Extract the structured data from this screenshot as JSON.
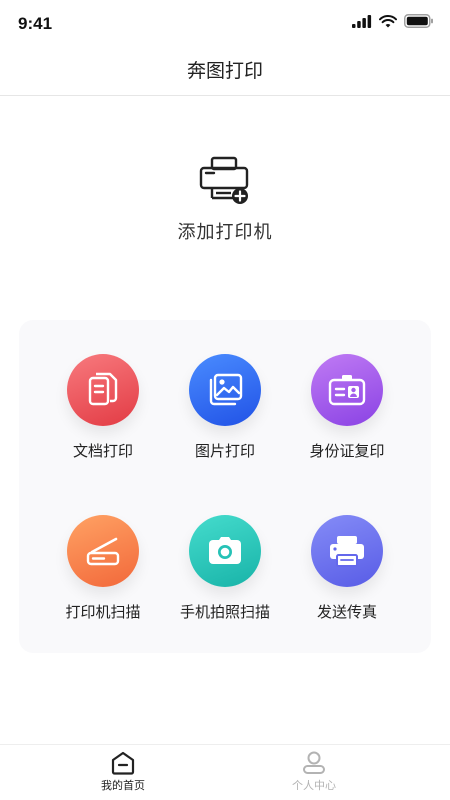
{
  "status_bar": {
    "time": "9:41"
  },
  "header": {
    "title": "奔图打印"
  },
  "add_printer": {
    "label": "添加打印机"
  },
  "features": [
    {
      "label": "文档打印",
      "icon": "document-icon",
      "color_from": "#f56a6f",
      "color_to": "#e43c45"
    },
    {
      "label": "图片打印",
      "icon": "image-icon",
      "color_from": "#3f86ff",
      "color_to": "#2559e8"
    },
    {
      "label": "身份证复印",
      "icon": "id-card-icon",
      "color_from": "#b970f2",
      "color_to": "#8e45e6"
    },
    {
      "label": "打印机扫描",
      "icon": "scanner-icon",
      "color_from": "#ff9a5e",
      "color_to": "#f46c3c"
    },
    {
      "label": "手机拍照扫描",
      "icon": "camera-icon",
      "color_from": "#3fd6c8",
      "color_to": "#1cb8ad"
    },
    {
      "label": "发送传真",
      "icon": "fax-icon",
      "color_from": "#7c83f5",
      "color_to": "#5c5fe8"
    }
  ],
  "tabbar": {
    "home": {
      "label": "我的首页",
      "active": true
    },
    "profile": {
      "label": "个人中心",
      "active": false
    }
  },
  "colors": {
    "tab_active": "#222222",
    "tab_inactive": "#b3b3b3",
    "card_bg": "#f9f9fb"
  }
}
